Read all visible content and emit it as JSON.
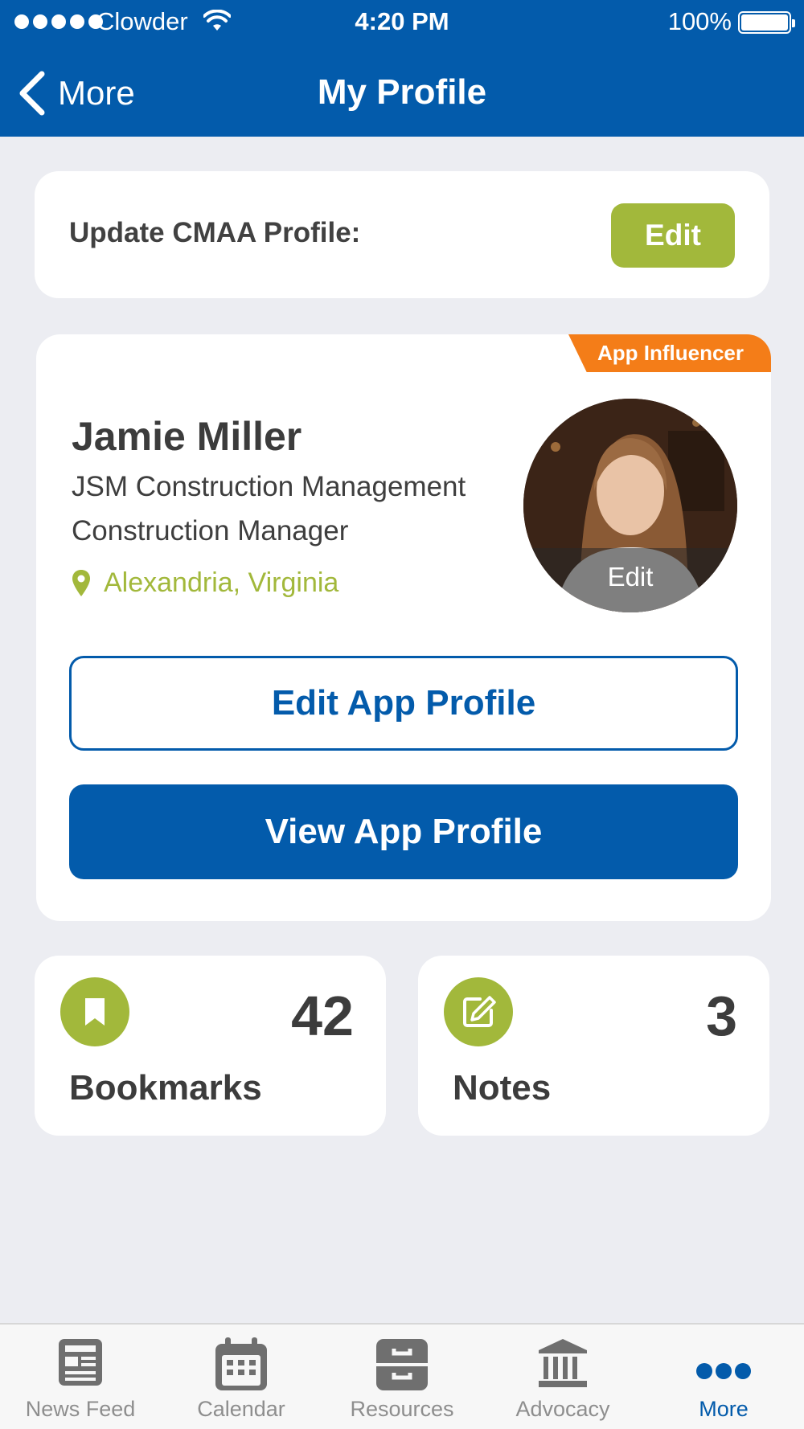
{
  "status_bar": {
    "carrier": "Clowder",
    "time": "4:20 PM",
    "battery": "100%"
  },
  "header": {
    "back_label": "More",
    "title": "My Profile"
  },
  "update_card": {
    "label": "Update CMAA Profile:",
    "edit_label": "Edit"
  },
  "profile": {
    "badge": "App Influencer",
    "name": "Jamie Miller",
    "company": "JSM Construction Management",
    "job_title": "Construction Manager",
    "location": "Alexandria, Virginia",
    "avatar_edit_label": "Edit",
    "edit_profile_label": "Edit App Profile",
    "view_profile_label": "View App Profile"
  },
  "stats": {
    "bookmarks": {
      "count": "42",
      "label": "Bookmarks",
      "icon": "bookmark-icon"
    },
    "notes": {
      "count": "3",
      "label": "Notes",
      "icon": "edit-note-icon"
    }
  },
  "tabs": [
    {
      "label": "News Feed",
      "icon": "newspaper-icon",
      "active": false
    },
    {
      "label": "Calendar",
      "icon": "calendar-icon",
      "active": false
    },
    {
      "label": "Resources",
      "icon": "cabinet-icon",
      "active": false
    },
    {
      "label": "Advocacy",
      "icon": "building-icon",
      "active": false
    },
    {
      "label": "More",
      "icon": "more-dots-icon",
      "active": true
    }
  ],
  "colors": {
    "brand_blue": "#035bab",
    "accent_green": "#a2b83b",
    "badge_orange": "#f47d18",
    "background": "#ecedf2"
  }
}
